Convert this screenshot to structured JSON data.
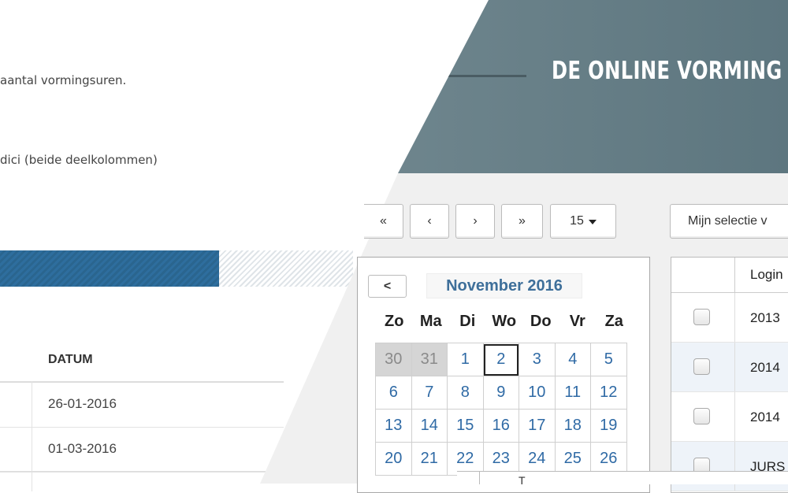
{
  "document": {
    "line1": "aantal vormingsuren.",
    "line2": "dici (beide deelkolommen)",
    "progress_fraction": 0.62,
    "table": {
      "header": "DATUM",
      "rows": [
        "26-01-2016",
        "01-03-2016"
      ]
    }
  },
  "banner": {
    "title": "DE ONLINE VORMING"
  },
  "toolbar": {
    "first_label": "«",
    "prev_label": "‹",
    "next_label": "›",
    "last_label": "»",
    "page_size": "15",
    "selection_label": "Mijn selectie v"
  },
  "calendar": {
    "prev_label": "<",
    "month_title": "November 2016",
    "weekdays": [
      "Zo",
      "Ma",
      "Di",
      "Wo",
      "Do",
      "Vr",
      "Za"
    ],
    "weeks": [
      [
        "30",
        "31",
        "1",
        "2",
        "3",
        "4",
        "5"
      ],
      [
        "6",
        "7",
        "8",
        "9",
        "10",
        "11",
        "12"
      ],
      [
        "13",
        "14",
        "15",
        "16",
        "17",
        "18",
        "19"
      ],
      [
        "20",
        "21",
        "22",
        "23",
        "24",
        "25",
        "26"
      ]
    ],
    "other_month_days": [
      "30",
      "31"
    ],
    "selected_day": "2"
  },
  "results_table": {
    "column_label": "Login",
    "rows": [
      "2013",
      "2014",
      "2014",
      "JURS"
    ]
  },
  "colors": {
    "accent_blue": "#2e6e9e",
    "calendar_link": "#2f6aa5",
    "banner": "#6e858d"
  },
  "bottom": {
    "fragment": "T"
  }
}
